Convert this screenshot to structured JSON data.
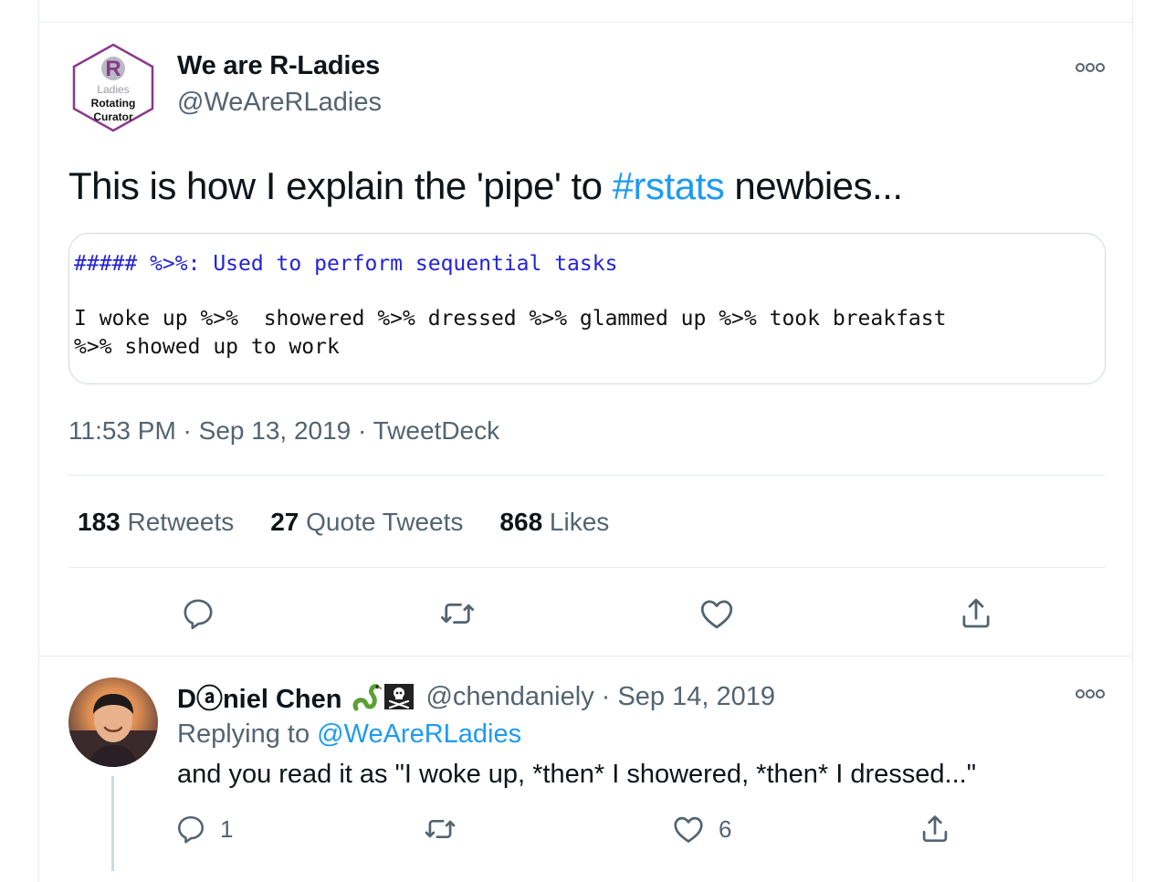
{
  "tweet": {
    "avatar": {
      "letter": "R",
      "lines": [
        "Ladies",
        "Rotating",
        "Curator"
      ],
      "accent": "#88398a"
    },
    "display_name": "We are R-Ladies",
    "handle": "@WeAreRLadies",
    "text_before": "This is how I explain the 'pipe' to ",
    "hashtag": "#rstats",
    "text_after": " newbies...",
    "code": {
      "comment": "##### %>%: Used to perform sequential tasks",
      "line1": "I woke up %>%  showered %>% dressed %>% glammed up %>% took breakfast",
      "line2": "%>% showed up to work"
    },
    "meta": "11:53 PM · Sep 13, 2019 · TweetDeck",
    "stats": {
      "retweets_count": "183",
      "retweets_label": "Retweets",
      "quotes_count": "27",
      "quotes_label": "Quote Tweets",
      "likes_count": "868",
      "likes_label": "Likes"
    }
  },
  "reply": {
    "display_name": "Dⓐniel Chen",
    "emoji": [
      "snake-icon",
      "pirate-flag-icon"
    ],
    "handle_date": "@chendaniely · Sep 14, 2019",
    "replying_prefix": "Replying to ",
    "replying_to": "@WeAreRLadies",
    "text": "and you read it as \"I woke up, *then* I showered, *then* I dressed...\"",
    "reply_count": "1",
    "like_count": "6"
  },
  "colors": {
    "link": "#1d9bf0",
    "secondary": "#536471",
    "code_comment": "#2323d8",
    "border": "#cfd9de"
  }
}
